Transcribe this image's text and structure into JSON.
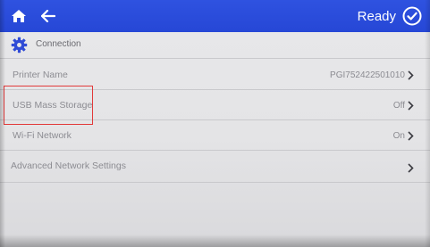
{
  "topbar": {
    "home_icon": "home-icon",
    "back_icon": "back-arrow-icon",
    "status": "Ready",
    "status_icon": "check-circle-icon",
    "accent": "#2a4bdb"
  },
  "section": {
    "icon": "gear-icon",
    "title": "Connection"
  },
  "rows": [
    {
      "label": "Printer Name",
      "value": "PGI752422501010"
    },
    {
      "label": "USB Mass Storage",
      "value": "Off"
    },
    {
      "label": "Wi-Fi Network",
      "value": "On"
    },
    {
      "label": "Advanced Network Settings",
      "value": ""
    }
  ],
  "annotation": {
    "color": "#e23a3a",
    "target": "USB Mass Storage"
  }
}
